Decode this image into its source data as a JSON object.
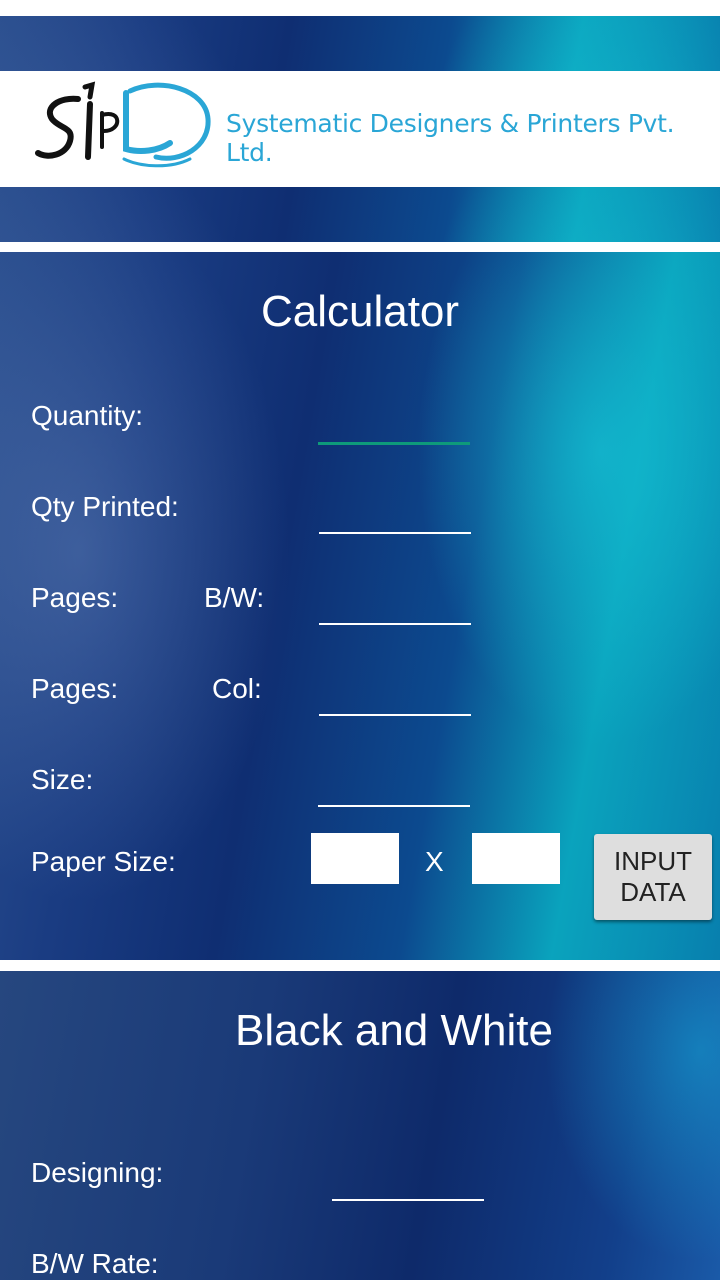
{
  "header": {
    "logo_text": "SPL",
    "company_name": "Systematic Designers & Printers Pvt. Ltd."
  },
  "calculator": {
    "title": "Calculator",
    "quantity_label": "Quantity:",
    "qty_printed_label": "Qty Printed:",
    "pages_bw_label": "Pages:",
    "bw_label": "B/W:",
    "pages_col_label": "Pages:",
    "col_label": "Col:",
    "size_label": "Size:",
    "paper_size_label": "Paper Size:",
    "x_label": "X",
    "input_button_label": "INPUT DATA"
  },
  "black_and_white": {
    "title": "Black and White",
    "designing_label": "Designing:",
    "bw_rate_label": "B/W Rate:"
  },
  "colors": {
    "accent_underline": "#0e9a7a",
    "logo_blue": "#2aa6d6"
  }
}
